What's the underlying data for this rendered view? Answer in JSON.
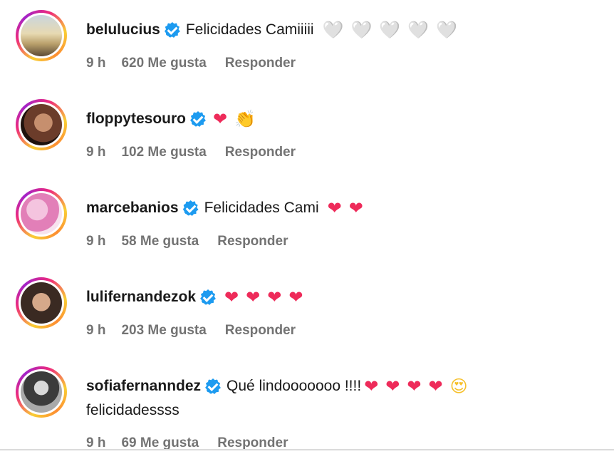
{
  "comments": [
    {
      "username": "belulucius",
      "text": "Felicidades Camiiiii",
      "emojis": [
        "🤍",
        "🤍",
        "🤍",
        "🤍",
        "🤍"
      ],
      "emoji_style": "heart-lilac",
      "continuation": "",
      "time": "9 h",
      "likes": "620 Me gusta",
      "reply": "Responder"
    },
    {
      "username": "floppytesouro",
      "text": "",
      "emojis": [
        "❤",
        "👏"
      ],
      "emoji_style": "mixed",
      "continuation": "",
      "time": "9 h",
      "likes": "102 Me gusta",
      "reply": "Responder"
    },
    {
      "username": "marcebanios",
      "text": "Felicidades Cami",
      "emojis": [
        "❤",
        "❤"
      ],
      "emoji_style": "heart-red",
      "continuation": "",
      "time": "9 h",
      "likes": "58 Me gusta",
      "reply": "Responder"
    },
    {
      "username": "lulifernandezok",
      "text": "",
      "emojis": [
        "❤",
        "❤",
        "❤",
        "❤"
      ],
      "emoji_style": "heart-red",
      "continuation": "",
      "time": "9 h",
      "likes": "203 Me gusta",
      "reply": "Responder"
    },
    {
      "username": "sofiafernanndez",
      "text": "Qué lindooooooo !!!!",
      "emojis": [
        "❤",
        "❤",
        "❤",
        "❤",
        "😍"
      ],
      "emoji_style": "mixed",
      "continuation": "felicidadessss",
      "time": "9 h",
      "likes": "69 Me gusta",
      "reply": "Responder"
    }
  ],
  "colors": {
    "verified_badge": "#1d9bf0",
    "meta_text": "#737373",
    "heart_red": "#ee2b5a",
    "heart_lilac": "#ddd3f2"
  }
}
